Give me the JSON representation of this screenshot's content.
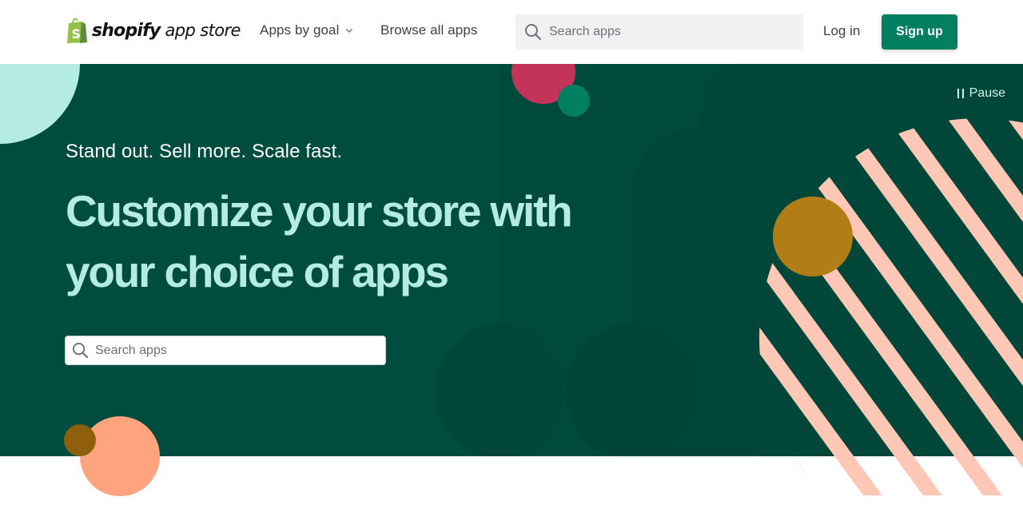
{
  "header": {
    "logo": {
      "brand": "shopify",
      "product": "app store",
      "icon": "shopify-bag-icon"
    },
    "nav": [
      {
        "label": "Apps by goal",
        "icon": "chevron-down-icon"
      },
      {
        "label": "Browse all apps"
      }
    ],
    "search": {
      "placeholder": "Search apps",
      "value": "",
      "icon": "search-icon"
    },
    "login_label": "Log in",
    "signup_label": "Sign up"
  },
  "hero": {
    "pause_label": "Pause",
    "pause_icon": "pause-icon",
    "tagline": "Stand out. Sell more. Scale fast.",
    "headline": "Customize your store with your choice of apps",
    "search": {
      "placeholder": "Search apps",
      "value": "",
      "icon": "search-icon"
    }
  },
  "colors": {
    "brand_green": "#008060",
    "hero_bg": "#004c3f",
    "headline": "#b4ece3",
    "logo_green": "#95bf47",
    "pink": "#c4345a",
    "mustard": "#b07d17",
    "peach": "#ffc8b6",
    "salmon": "#ffa47f",
    "mint": "#b4ece3"
  }
}
